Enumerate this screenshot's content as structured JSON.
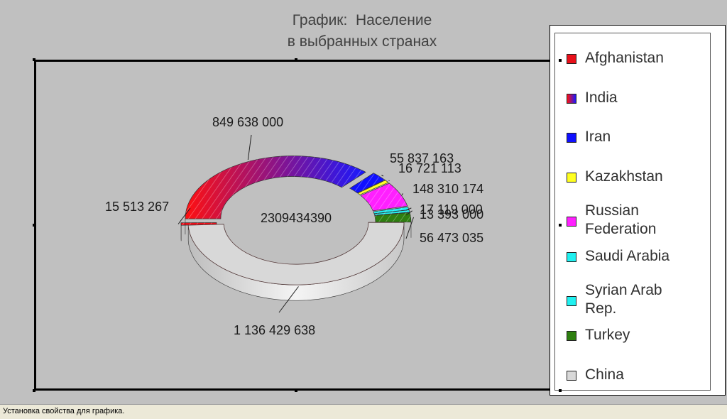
{
  "title": {
    "line1": "График:  Население",
    "line2": "в выбранных странах"
  },
  "colors": {
    "Afghanistan": "#e8101a",
    "India_start": "#ff1010",
    "India_end": "#1818ff",
    "Iran": "#1010ff",
    "Kazakhstan": "#ffff20",
    "Russian Federation": "#ff20ff",
    "Saudi Arabia": "#20f0f0",
    "Syrian Arab Rep.": "#20f0f0",
    "Turkey": "#2e7f10",
    "China": "#d8d8d8"
  },
  "chart_data": {
    "type": "pie",
    "subtype": "3d-doughnut",
    "title": "График:  Население в выбранных странах",
    "center_label": "2309434390",
    "legend_placement": "right",
    "slices": [
      {
        "name": "Afghanistan",
        "value": 15513267,
        "label": "15 513 267"
      },
      {
        "name": "India",
        "value": 849638000,
        "label": "849 638 000"
      },
      {
        "name": "Iran",
        "value": 55837163,
        "label": "55 837 163"
      },
      {
        "name": "Kazakhstan",
        "value": 16721113,
        "label": "16 721 113"
      },
      {
        "name": "Russian Federation",
        "value": 148310174,
        "label": "148 310 174"
      },
      {
        "name": "Saudi Arabia",
        "value": 17119000,
        "label": "17 119 000"
      },
      {
        "name": "Syrian Arab Rep.",
        "value": 13393000,
        "label": "13 393 000"
      },
      {
        "name": "Turkey",
        "value": 56473035,
        "label": "56 473 035"
      },
      {
        "name": "China",
        "value": 1136429638,
        "label": "1 136 429 638"
      }
    ]
  },
  "legend": {
    "items": [
      {
        "label": "Afghanistan",
        "icon": "swatch-red"
      },
      {
        "label": "India",
        "icon": "swatch-red-blue-gradient"
      },
      {
        "label": "Iran",
        "icon": "swatch-blue"
      },
      {
        "label": "Kazakhstan",
        "icon": "swatch-yellow"
      },
      {
        "label": "Russian\nFederation",
        "icon": "swatch-magenta"
      },
      {
        "label": "Saudi Arabia",
        "icon": "swatch-cyan"
      },
      {
        "label": "Syrian Arab\nRep.",
        "icon": "swatch-cyan"
      },
      {
        "label": "Turkey",
        "icon": "swatch-green"
      },
      {
        "label": "China",
        "icon": "swatch-gray"
      }
    ]
  },
  "status": {
    "text": "Установка свойства для графика."
  }
}
